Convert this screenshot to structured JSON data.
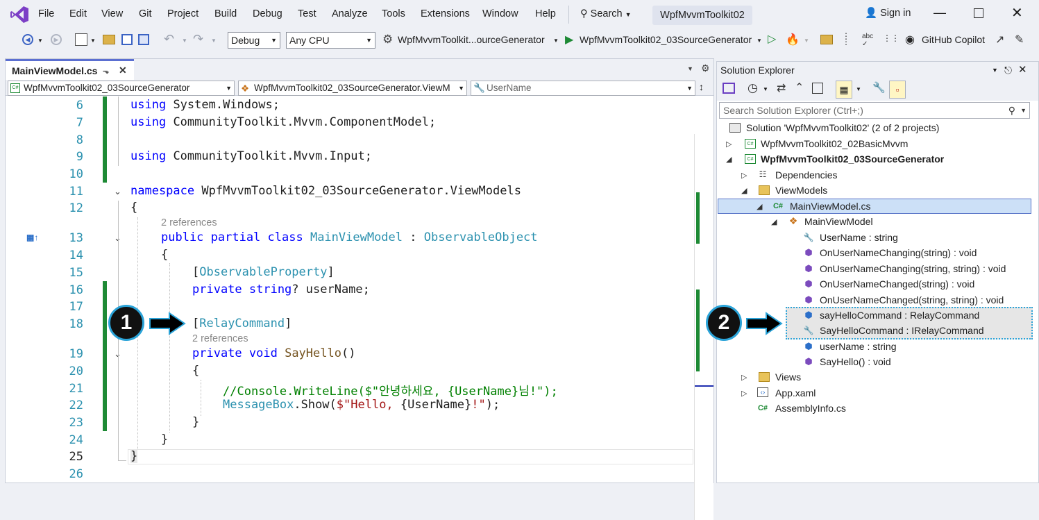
{
  "menu": {
    "items": [
      "File",
      "Edit",
      "View",
      "Git",
      "Project",
      "Build",
      "Debug",
      "Test",
      "Analyze",
      "Tools",
      "Extensions",
      "Window",
      "Help"
    ],
    "search_label": "Search",
    "solution_title": "WpfMvvmToolkit02",
    "sign_in": "Sign in"
  },
  "toolbar": {
    "config": "Debug",
    "platform": "Any CPU",
    "startup_project": "WpfMvvmToolkit...ourceGenerator",
    "run_target": "WpfMvvmToolkit02_03SourceGenerator",
    "copilot": "GitHub Copilot"
  },
  "editor": {
    "tab_title": "MainViewModel.cs",
    "nav_project": "WpfMvvmToolkit02_03SourceGenerator",
    "nav_type": "WpfMvvmToolkit02_03SourceGenerator.ViewM",
    "nav_member": "UserName",
    "line_numbers": [
      "6",
      "7",
      "8",
      "9",
      "10",
      "11",
      "12",
      "13",
      "14",
      "15",
      "16",
      "17",
      "18",
      "19",
      "20",
      "21",
      "22",
      "23",
      "24",
      "25",
      "26"
    ],
    "code": {
      "l6": "System.Windows;",
      "l7": "CommunityToolkit.Mvvm.ComponentModel;",
      "l9": "CommunityToolkit.Mvvm.Input;",
      "kw_using": "using",
      "kw_namespace": "namespace",
      "ns_name": "WpfMvvmToolkit02_03SourceGenerator.ViewModels",
      "open_brace": "{",
      "close_brace": "}",
      "refs_class": "2 references",
      "class_mods": "public partial class",
      "class_name": "MainViewModel",
      "colon": ":",
      "base_type": "ObservableObject",
      "attr_observable": "ObservableProperty",
      "field_mods": "private string",
      "field_rest": "? userName;",
      "attr_relay": "RelayCommand",
      "refs_method": "2 references",
      "method_mods": "private void",
      "method_name": "SayHello",
      "method_parens": "()",
      "comment_line": "//Console.WriteLine($\"안녕하세요, {UserName}님!\");",
      "msgbox_type": "MessageBox",
      "msgbox_call": ".Show(",
      "msgbox_str1": "$\"Hello, ",
      "msgbox_interp": "{UserName}",
      "msgbox_str2": "!\"",
      "msgbox_end": ");"
    },
    "callout_1": "1"
  },
  "solution_explorer": {
    "title": "Solution Explorer",
    "search_placeholder": "Search Solution Explorer (Ctrl+;)",
    "solution": "Solution 'WpfMvvmToolkit02' (2 of 2 projects)",
    "project1": "WpfMvvmToolkit02_02BasicMvvm",
    "project2": "WpfMvvmToolkit02_03SourceGenerator",
    "dependencies": "Dependencies",
    "viewmodels_folder": "ViewModels",
    "file": "MainViewModel.cs",
    "class": "MainViewModel",
    "members": [
      "UserName : string",
      "OnUserNameChanging(string) : void",
      "OnUserNameChanging(string, string) : void",
      "OnUserNameChanged(string) : void",
      "OnUserNameChanged(string, string) : void",
      "sayHelloCommand : RelayCommand",
      "SayHelloCommand : IRelayCommand",
      "userName : string",
      "SayHello() : void"
    ],
    "views_folder": "Views",
    "app_xaml": "App.xaml",
    "assembly_info": "AssemblyInfo.cs",
    "callout_2": "2",
    "cs_badge": "C#"
  }
}
